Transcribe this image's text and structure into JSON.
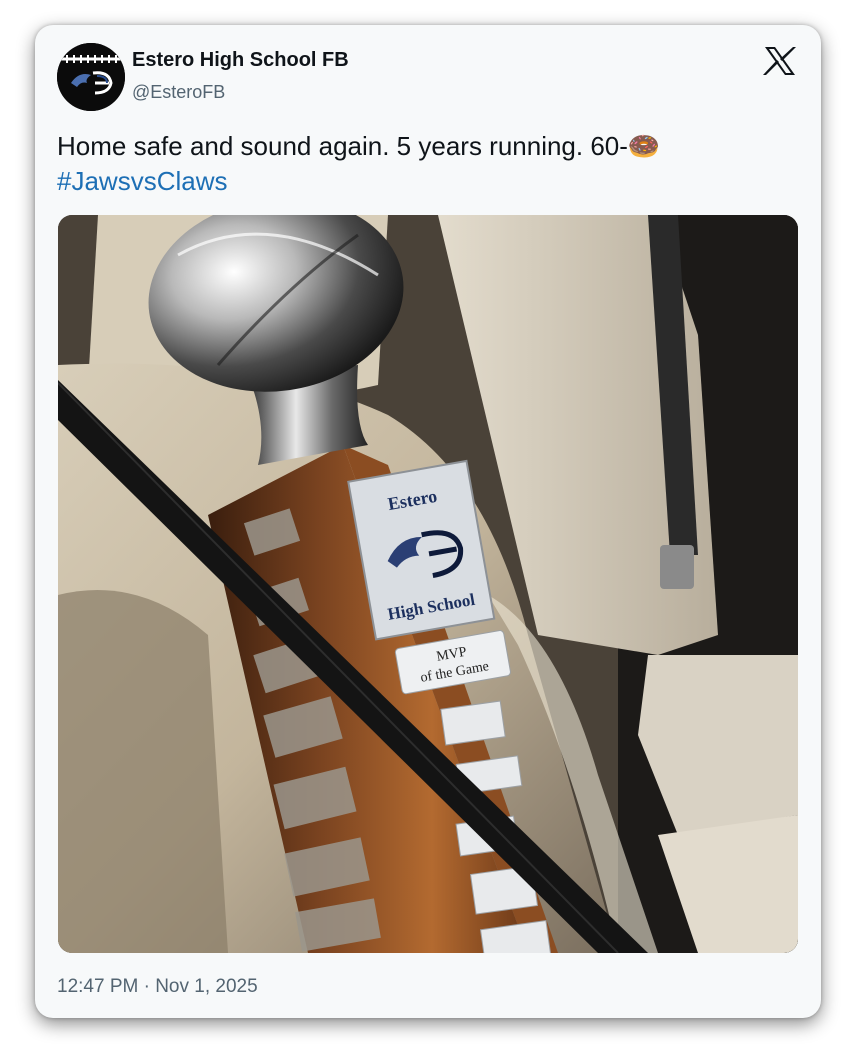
{
  "author": {
    "display_name": "Estero High School FB",
    "handle": "@EsteroFB"
  },
  "tweet": {
    "text": "Home safe and sound again. 5 years running. 60-",
    "emoji": "🍩",
    "hashtag": "#JawsvsClaws"
  },
  "photo": {
    "plaque_school_top": "Estero",
    "plaque_school_bottom": "High School",
    "mvp_line1": "MVP",
    "mvp_line2": "of the Game"
  },
  "meta": {
    "timestamp": "12:47 PM · Nov 1, 2025"
  },
  "icons": {
    "platform": "x-logo-icon"
  }
}
